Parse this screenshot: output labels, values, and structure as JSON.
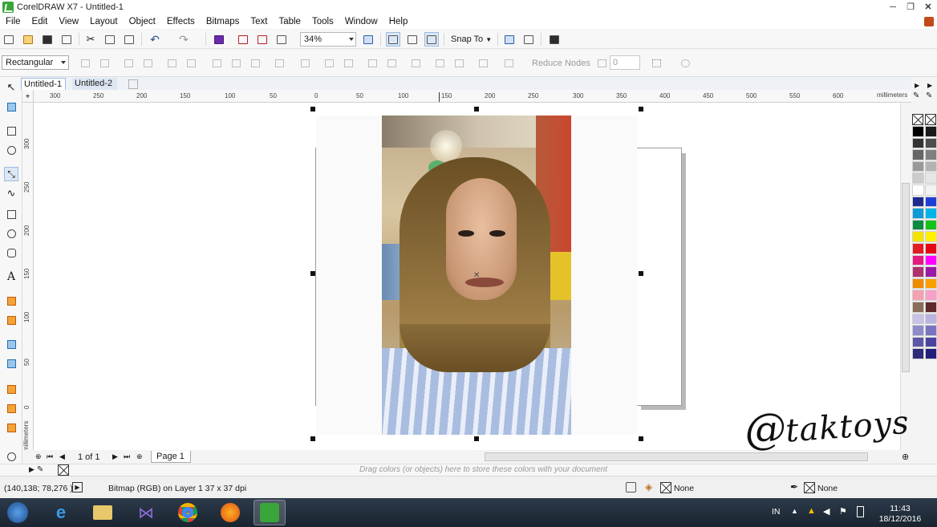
{
  "window": {
    "title": "CorelDRAW X7 - Untitled-1"
  },
  "menu": [
    "File",
    "Edit",
    "View",
    "Layout",
    "Object",
    "Effects",
    "Bitmaps",
    "Text",
    "Table",
    "Tools",
    "Window",
    "Help"
  ],
  "toolbar": {
    "zoom": "34%",
    "snap_to": "Snap To"
  },
  "property_bar": {
    "shape_mode": "Rectangular",
    "reduce_nodes": "Reduce Nodes",
    "node_value": "0"
  },
  "tabs": [
    "Untitled-1",
    "Untitled-2"
  ],
  "ruler": {
    "h_ticks": [
      "300",
      "250",
      "200",
      "150",
      "100",
      "50",
      "0",
      "50",
      "100",
      "150",
      "200",
      "250",
      "300",
      "350",
      "400",
      "450",
      "500",
      "550",
      "600"
    ],
    "h_unit": "millimeters",
    "v_ticks": [
      "300",
      "250",
      "200",
      "150",
      "100",
      "50",
      "0"
    ],
    "v_unit": "millimeters"
  },
  "page_nav": {
    "count": "1 of 1",
    "page_label": "Page 1"
  },
  "palette_hint": "Drag colors (or objects) here to store these colors with your document",
  "status": {
    "coords": "(140,138; 78,276 )",
    "object_info": "Bitmap (RGB) on Layer 1 37 x 37 dpi",
    "fill": "None",
    "outline": "None"
  },
  "taskbar": {
    "lang": "IN",
    "time": "11:43",
    "date": "18/12/2016"
  },
  "watermark": {
    "at": "@",
    "name": "taktoys"
  },
  "colors": {
    "selection_blue": "#9bbce3",
    "palette": [
      "#000000",
      "#1a1a1a",
      "#333333",
      "#4d4d4d",
      "#666666",
      "#808080",
      "#999999",
      "#b3b3b3",
      "#cccccc",
      "#e6e6e6",
      "#ffffff",
      "#f2f2f2",
      "#1f2a8c",
      "#1d3fd3",
      "#0e9bd8",
      "#00b4e8",
      "#0a8a43",
      "#15c21b",
      "#f2e400",
      "#fff200",
      "#e31b23",
      "#e30613",
      "#e5197f",
      "#ff00ff",
      "#b0306e",
      "#9b1aa5",
      "#f08a00",
      "#f7a000",
      "#f4a1b2",
      "#f8a0c8",
      "#8a6d5a",
      "#5f2a2a",
      "#c7c2e6",
      "#b9b3e0",
      "#8f8ac9",
      "#7a74c0",
      "#5d56a8",
      "#4a44a0",
      "#2e2a7a",
      "#20207a"
    ]
  }
}
